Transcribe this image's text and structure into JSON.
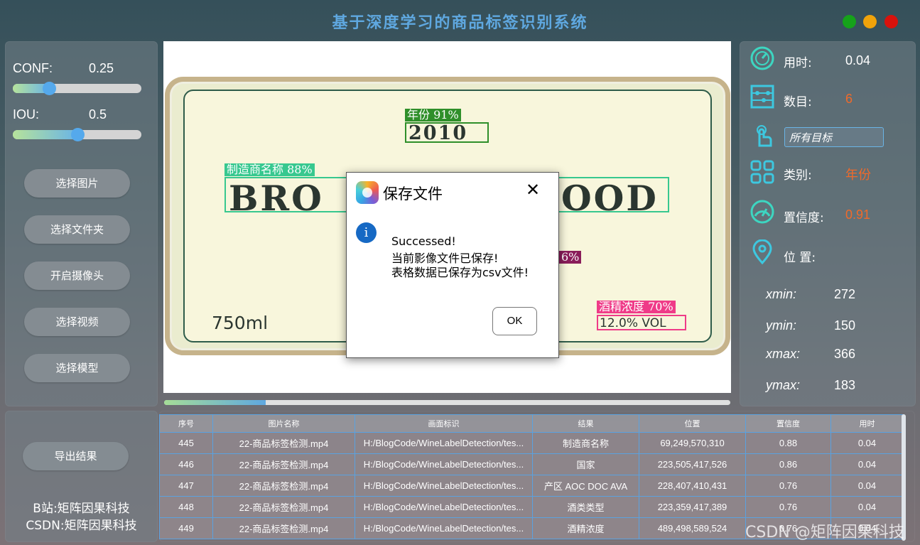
{
  "app": {
    "title": "基于深度学习的商品标签识别系统"
  },
  "window_controls": [
    "minimize",
    "maximize",
    "close"
  ],
  "sliders": {
    "conf": {
      "label": "CONF:",
      "value": "0.25",
      "level": 0.28
    },
    "iou": {
      "label": "IOU:",
      "value": "0.5",
      "level": 0.5
    }
  },
  "sidebar": {
    "buttons": [
      {
        "label": "选择图片"
      },
      {
        "label": "选择文件夹"
      },
      {
        "label": "开启摄像头"
      },
      {
        "label": "选择视频"
      },
      {
        "label": "选择模型"
      }
    ],
    "export_label": "导出结果",
    "credits": [
      "B站:矩阵因果科技",
      "CSDN:矩阵因果科技"
    ]
  },
  "preview": {
    "progress": 0.18,
    "label_texts": {
      "year_value": "2010",
      "brand": "BRO",
      "brand_end": "OOD",
      "volume": "750ml",
      "alcohol_value": "12.0% VOL"
    },
    "detections": [
      {
        "tag": "年份 91%",
        "color": "#2f8f2a"
      },
      {
        "tag": "制造商名称 88%",
        "color": "#37c88f"
      },
      {
        "tag": "6%",
        "color": "#8a1d5a"
      },
      {
        "tag": "酒精浓度 70%",
        "color": "#ef3b88"
      }
    ]
  },
  "dialog": {
    "title": "保存文件",
    "close_glyph": "✕",
    "info_glyph": "i",
    "lines": [
      "Successed!",
      "当前影像文件已保存!",
      "表格数据已保存为csv文件!"
    ],
    "ok_label": "OK"
  },
  "stats": {
    "time": {
      "label": "用时:",
      "value": "0.04"
    },
    "count": {
      "label": "数目:",
      "value": "6"
    },
    "target": {
      "value": "所有目标"
    },
    "category": {
      "label": "类别:",
      "value": "年份"
    },
    "confidence": {
      "label": "置信度:",
      "value": "0.91"
    },
    "position": {
      "label": "位 置:"
    },
    "coords": [
      {
        "label": "xmin:",
        "value": "272"
      },
      {
        "label": "ymin:",
        "value": "150"
      },
      {
        "label": "xmax:",
        "value": "366"
      },
      {
        "label": "ymax:",
        "value": "183"
      }
    ]
  },
  "table": {
    "headers": [
      "序号",
      "图片名称",
      "画面标识",
      "结果",
      "位置",
      "置信度",
      "用时"
    ],
    "rows": [
      [
        "445",
        "22-商品标签检测.mp4",
        "H:/BlogCode/WineLabelDetection/tes...",
        "制造商名称",
        "69,249,570,310",
        "0.88",
        "0.04"
      ],
      [
        "446",
        "22-商品标签检测.mp4",
        "H:/BlogCode/WineLabelDetection/tes...",
        "国家",
        "223,505,417,526",
        "0.86",
        "0.04"
      ],
      [
        "447",
        "22-商品标签检测.mp4",
        "H:/BlogCode/WineLabelDetection/tes...",
        "产区 AOC DOC AVA",
        "228,407,410,431",
        "0.76",
        "0.04"
      ],
      [
        "448",
        "22-商品标签检测.mp4",
        "H:/BlogCode/WineLabelDetection/tes...",
        "酒类类型",
        "223,359,417,389",
        "0.76",
        "0.04"
      ],
      [
        "449",
        "22-商品标签检测.mp4",
        "H:/BlogCode/WineLabelDetection/tes...",
        "酒精浓度",
        "489,498,589,524",
        "0.76",
        "0.04"
      ]
    ]
  },
  "watermark": "CSDN @矩阵因果科技",
  "colors": {
    "accent": "#5fa8e0",
    "value_orange": "#f06a2a",
    "table_border": "#5aa2e0"
  },
  "icons": {
    "time": "speedometer-icon",
    "count": "abacus-icon",
    "target": "pointer-hand-icon",
    "category": "grid-icon",
    "confidence": "gauge-icon",
    "position": "location-pin-icon"
  }
}
